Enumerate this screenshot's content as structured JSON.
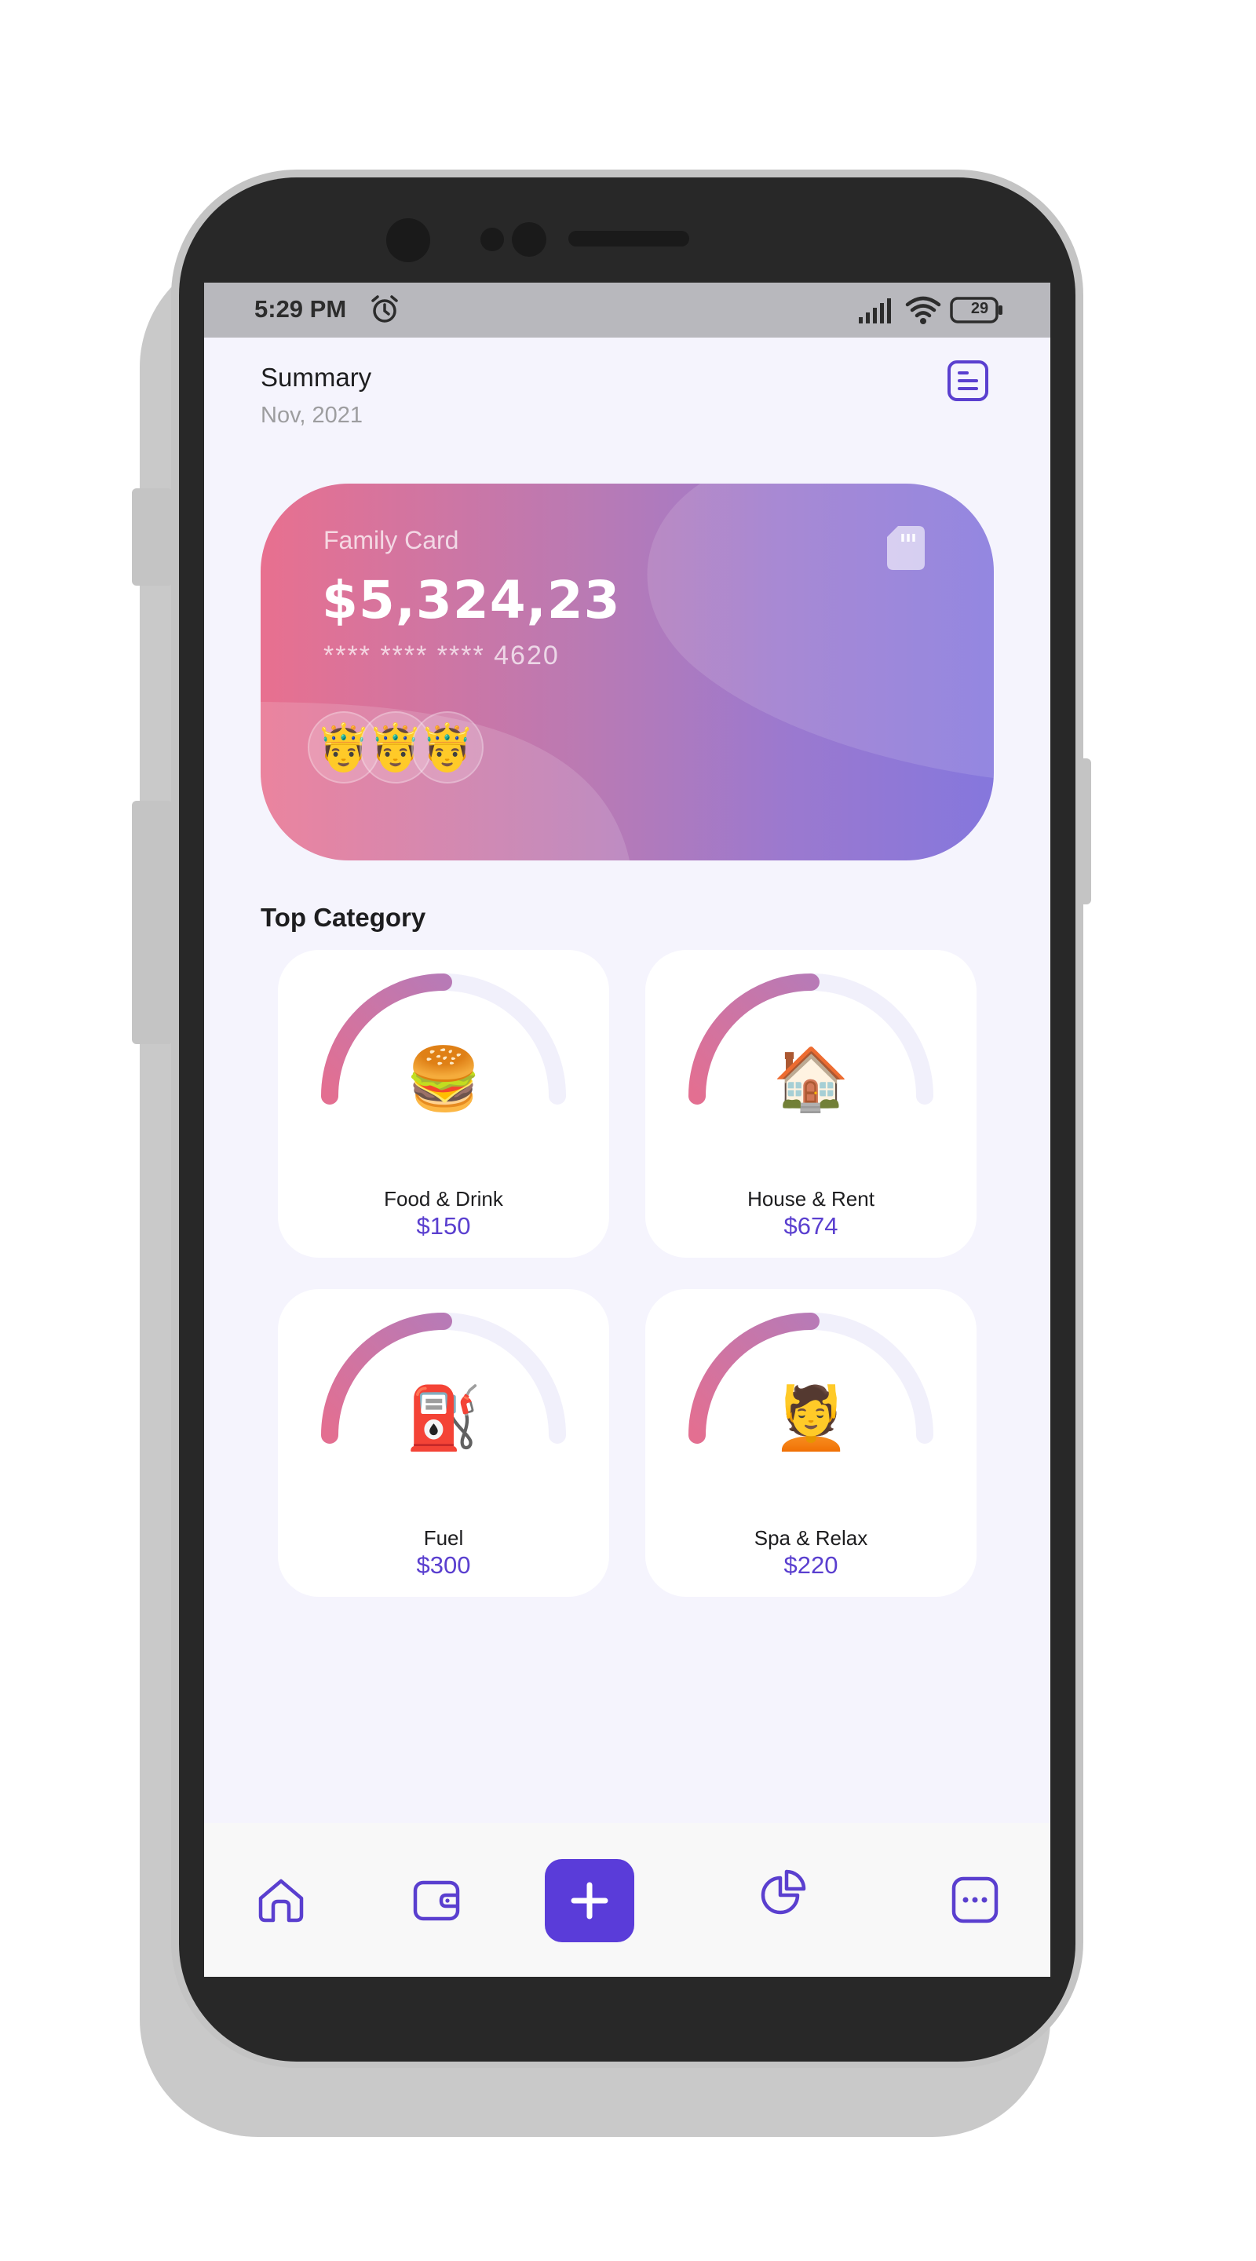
{
  "status_bar": {
    "time": "5:29 PM",
    "battery": "29",
    "icons": [
      "alarm-icon",
      "signal-icon",
      "wifi-icon",
      "battery-icon"
    ]
  },
  "header": {
    "title": "Summary",
    "subtitle": "Nov, 2021",
    "menu_icon": "document-list-icon"
  },
  "card": {
    "label": "Family Card",
    "amount": "$5,324,23",
    "number_mask": "**** **** ****",
    "number_last4": "4620",
    "members": [
      "🤴",
      "🤴",
      "🤴"
    ],
    "icon": "sim-card-icon",
    "gradient_start": "#e8708f",
    "gradient_end": "#8577dd"
  },
  "top_category": {
    "title": "Top Category",
    "items": [
      {
        "label": "Food & Drink",
        "value": "$150",
        "emoji": "🍔",
        "progress": 0.5
      },
      {
        "label": "House & Rent",
        "value": "$674",
        "emoji": "🏠",
        "progress": 0.5
      },
      {
        "label": "Fuel",
        "value": "$300",
        "emoji": "⛽",
        "progress": 0.5
      },
      {
        "label": "Spa & Relax",
        "value": "$220",
        "emoji": "💆",
        "progress": 0.5
      }
    ]
  },
  "bottom_nav": {
    "items": [
      "home-icon",
      "wallet-icon",
      "add-icon",
      "pie-chart-icon",
      "more-icon"
    ],
    "accent": "#5a3cd9"
  },
  "colors": {
    "accent": "#5a3fcf",
    "gauge_track": "#f1f0fb",
    "gauge_start": "#e36f91",
    "gauge_end": "#b87ab6"
  }
}
